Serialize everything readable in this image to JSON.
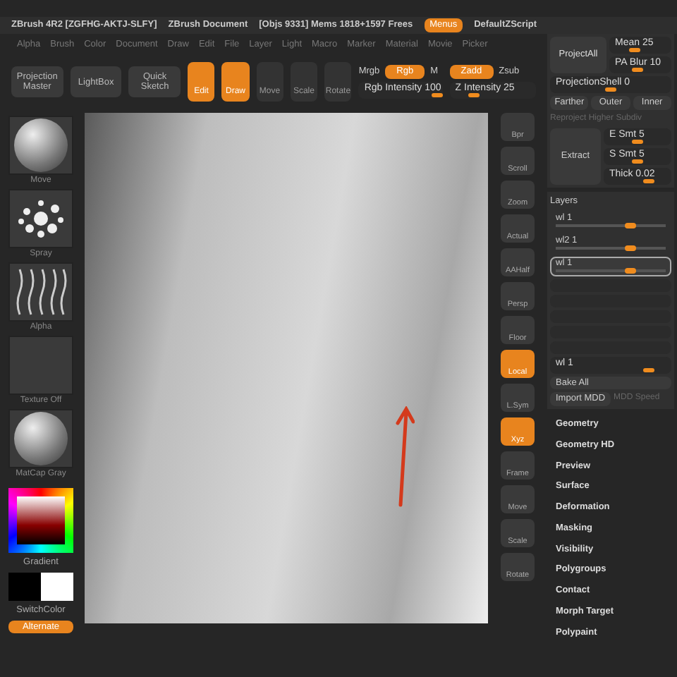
{
  "title_bar": {
    "texts": [
      "ZBrush 4R2 [ZGFHG-AKTJ-SLFY]",
      "ZBrush Document",
      "[Objs 9331] Mems 1818+1597 Frees"
    ],
    "menus_button": {
      "label": "Menus",
      "on": true
    },
    "script": "DefaultZScript"
  },
  "menu_bar": [
    "Alpha",
    "Brush",
    "Color",
    "Document",
    "Draw",
    "Edit",
    "File",
    "Layer",
    "Light",
    "Macro",
    "Marker",
    "Material",
    "Movie",
    "Picker"
  ],
  "toolbar": {
    "buttons": [
      {
        "label": "Projection Master",
        "kind": "wide"
      },
      {
        "label": "LightBox",
        "kind": "wide"
      },
      {
        "label": "Quick Sketch",
        "kind": "wide"
      },
      {
        "label": "Edit",
        "kind": "mode",
        "on": true
      },
      {
        "label": "Draw",
        "kind": "mode",
        "on": true
      },
      {
        "label": "Move",
        "kind": "mode",
        "on": false
      },
      {
        "label": "Scale",
        "kind": "mode",
        "on": false
      },
      {
        "label": "Rotate",
        "kind": "mode",
        "on": false
      }
    ],
    "color_controls": {
      "mrgb": "Mrgb",
      "rgb": {
        "label": "Rgb",
        "on": true
      },
      "m": "M",
      "rgb_intensity": {
        "label": "Rgb Intensity 100",
        "level": 1.0
      }
    },
    "depth_controls": {
      "zadd": {
        "label": "Zadd",
        "on": true
      },
      "zsub": "Zsub",
      "z_intensity": {
        "label": "Z Intensity 25",
        "level": 0.25
      }
    }
  },
  "left_shelf": {
    "thumbnails": [
      {
        "label": "Move",
        "kind": "sphere"
      },
      {
        "label": "Spray",
        "kind": "dots"
      },
      {
        "label": "Alpha",
        "kind": "strokes"
      },
      {
        "label": "Texture Off",
        "kind": "empty"
      },
      {
        "label": "MatCap Gray",
        "kind": "sphere"
      }
    ],
    "gradient": "Gradient",
    "switch_color": "SwitchColor",
    "alternate": {
      "label": "Alternate",
      "on": true
    }
  },
  "right_shelf": [
    {
      "label": "Bpr",
      "on": false
    },
    {
      "label": "Scroll",
      "on": false
    },
    {
      "label": "Zoom",
      "on": false
    },
    {
      "label": "Actual",
      "on": false
    },
    {
      "label": "AAHalf",
      "on": false
    },
    {
      "label": "Persp",
      "on": false
    },
    {
      "label": "Floor",
      "on": false
    },
    {
      "label": "Local",
      "on": true
    },
    {
      "label": "L.Sym",
      "on": false
    },
    {
      "label": "Xyz",
      "on": true
    },
    {
      "label": "Frame",
      "on": false
    },
    {
      "label": "Move",
      "on": false
    },
    {
      "label": "Scale",
      "on": false
    },
    {
      "label": "Rotate",
      "on": false
    }
  ],
  "projection": {
    "project_all": "ProjectAll",
    "mean": {
      "label": "Mean 25",
      "level": 0.4
    },
    "pa_blur": {
      "label": "PA Blur 10",
      "level": 0.45
    },
    "shell": {
      "label": "ProjectionShell 0",
      "level": 0.5
    },
    "buttons": [
      "Farther",
      "Outer",
      "Inner"
    ],
    "reproject": "Reproject Higher Subdiv"
  },
  "extract": {
    "button": "Extract",
    "sliders": [
      {
        "label": "E Smt 5",
        "level": 0.5
      },
      {
        "label": "S Smt 5",
        "level": 0.5
      },
      {
        "label": "Thick 0.02",
        "level": 0.7
      }
    ]
  },
  "layers": {
    "title": "Layers",
    "items": [
      {
        "name": "wl 1",
        "level": 0.7,
        "selected": false
      },
      {
        "name": "wl2 1",
        "level": 0.7,
        "selected": false
      },
      {
        "name": "wl 1",
        "level": 0.7,
        "selected": true
      }
    ],
    "master": {
      "label": "wl 1",
      "level": 0.85
    },
    "bake_all": "Bake All",
    "import_mdd": "Import MDD",
    "mdd_speed": "MDD Speed"
  },
  "tool_menu": [
    "Geometry",
    "Geometry HD",
    "Preview",
    "Surface",
    "Deformation",
    "Masking",
    "Visibility",
    "Polygroups",
    "Contact",
    "Morph Target",
    "Polypaint"
  ]
}
